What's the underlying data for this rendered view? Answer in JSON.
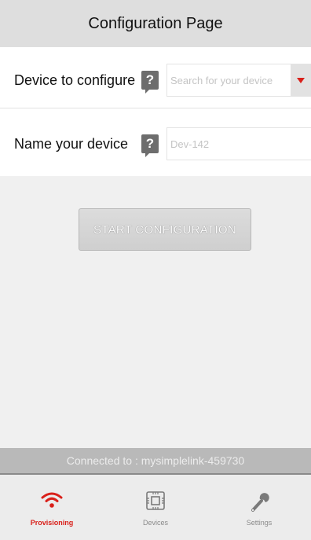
{
  "header": {
    "title": "Configuration Page"
  },
  "form": {
    "device": {
      "label": "Device to configure",
      "help": "?",
      "placeholder": "Search for your device",
      "value": ""
    },
    "name": {
      "label": "Name your device",
      "help": "?",
      "placeholder": "Dev-142",
      "value": ""
    }
  },
  "start_button": "START CONFIGURATION",
  "status": "Connected to : mysimplelink-459730",
  "tabs": [
    {
      "label": "Provisioning",
      "icon": "wifi-icon",
      "active": true
    },
    {
      "label": "Devices",
      "icon": "chip-icon",
      "active": false
    },
    {
      "label": "Settings",
      "icon": "wrench-icon",
      "active": false
    }
  ],
  "colors": {
    "accent": "#d9201a",
    "header_bg": "#dedede",
    "status_bg": "#b9b9b9"
  }
}
